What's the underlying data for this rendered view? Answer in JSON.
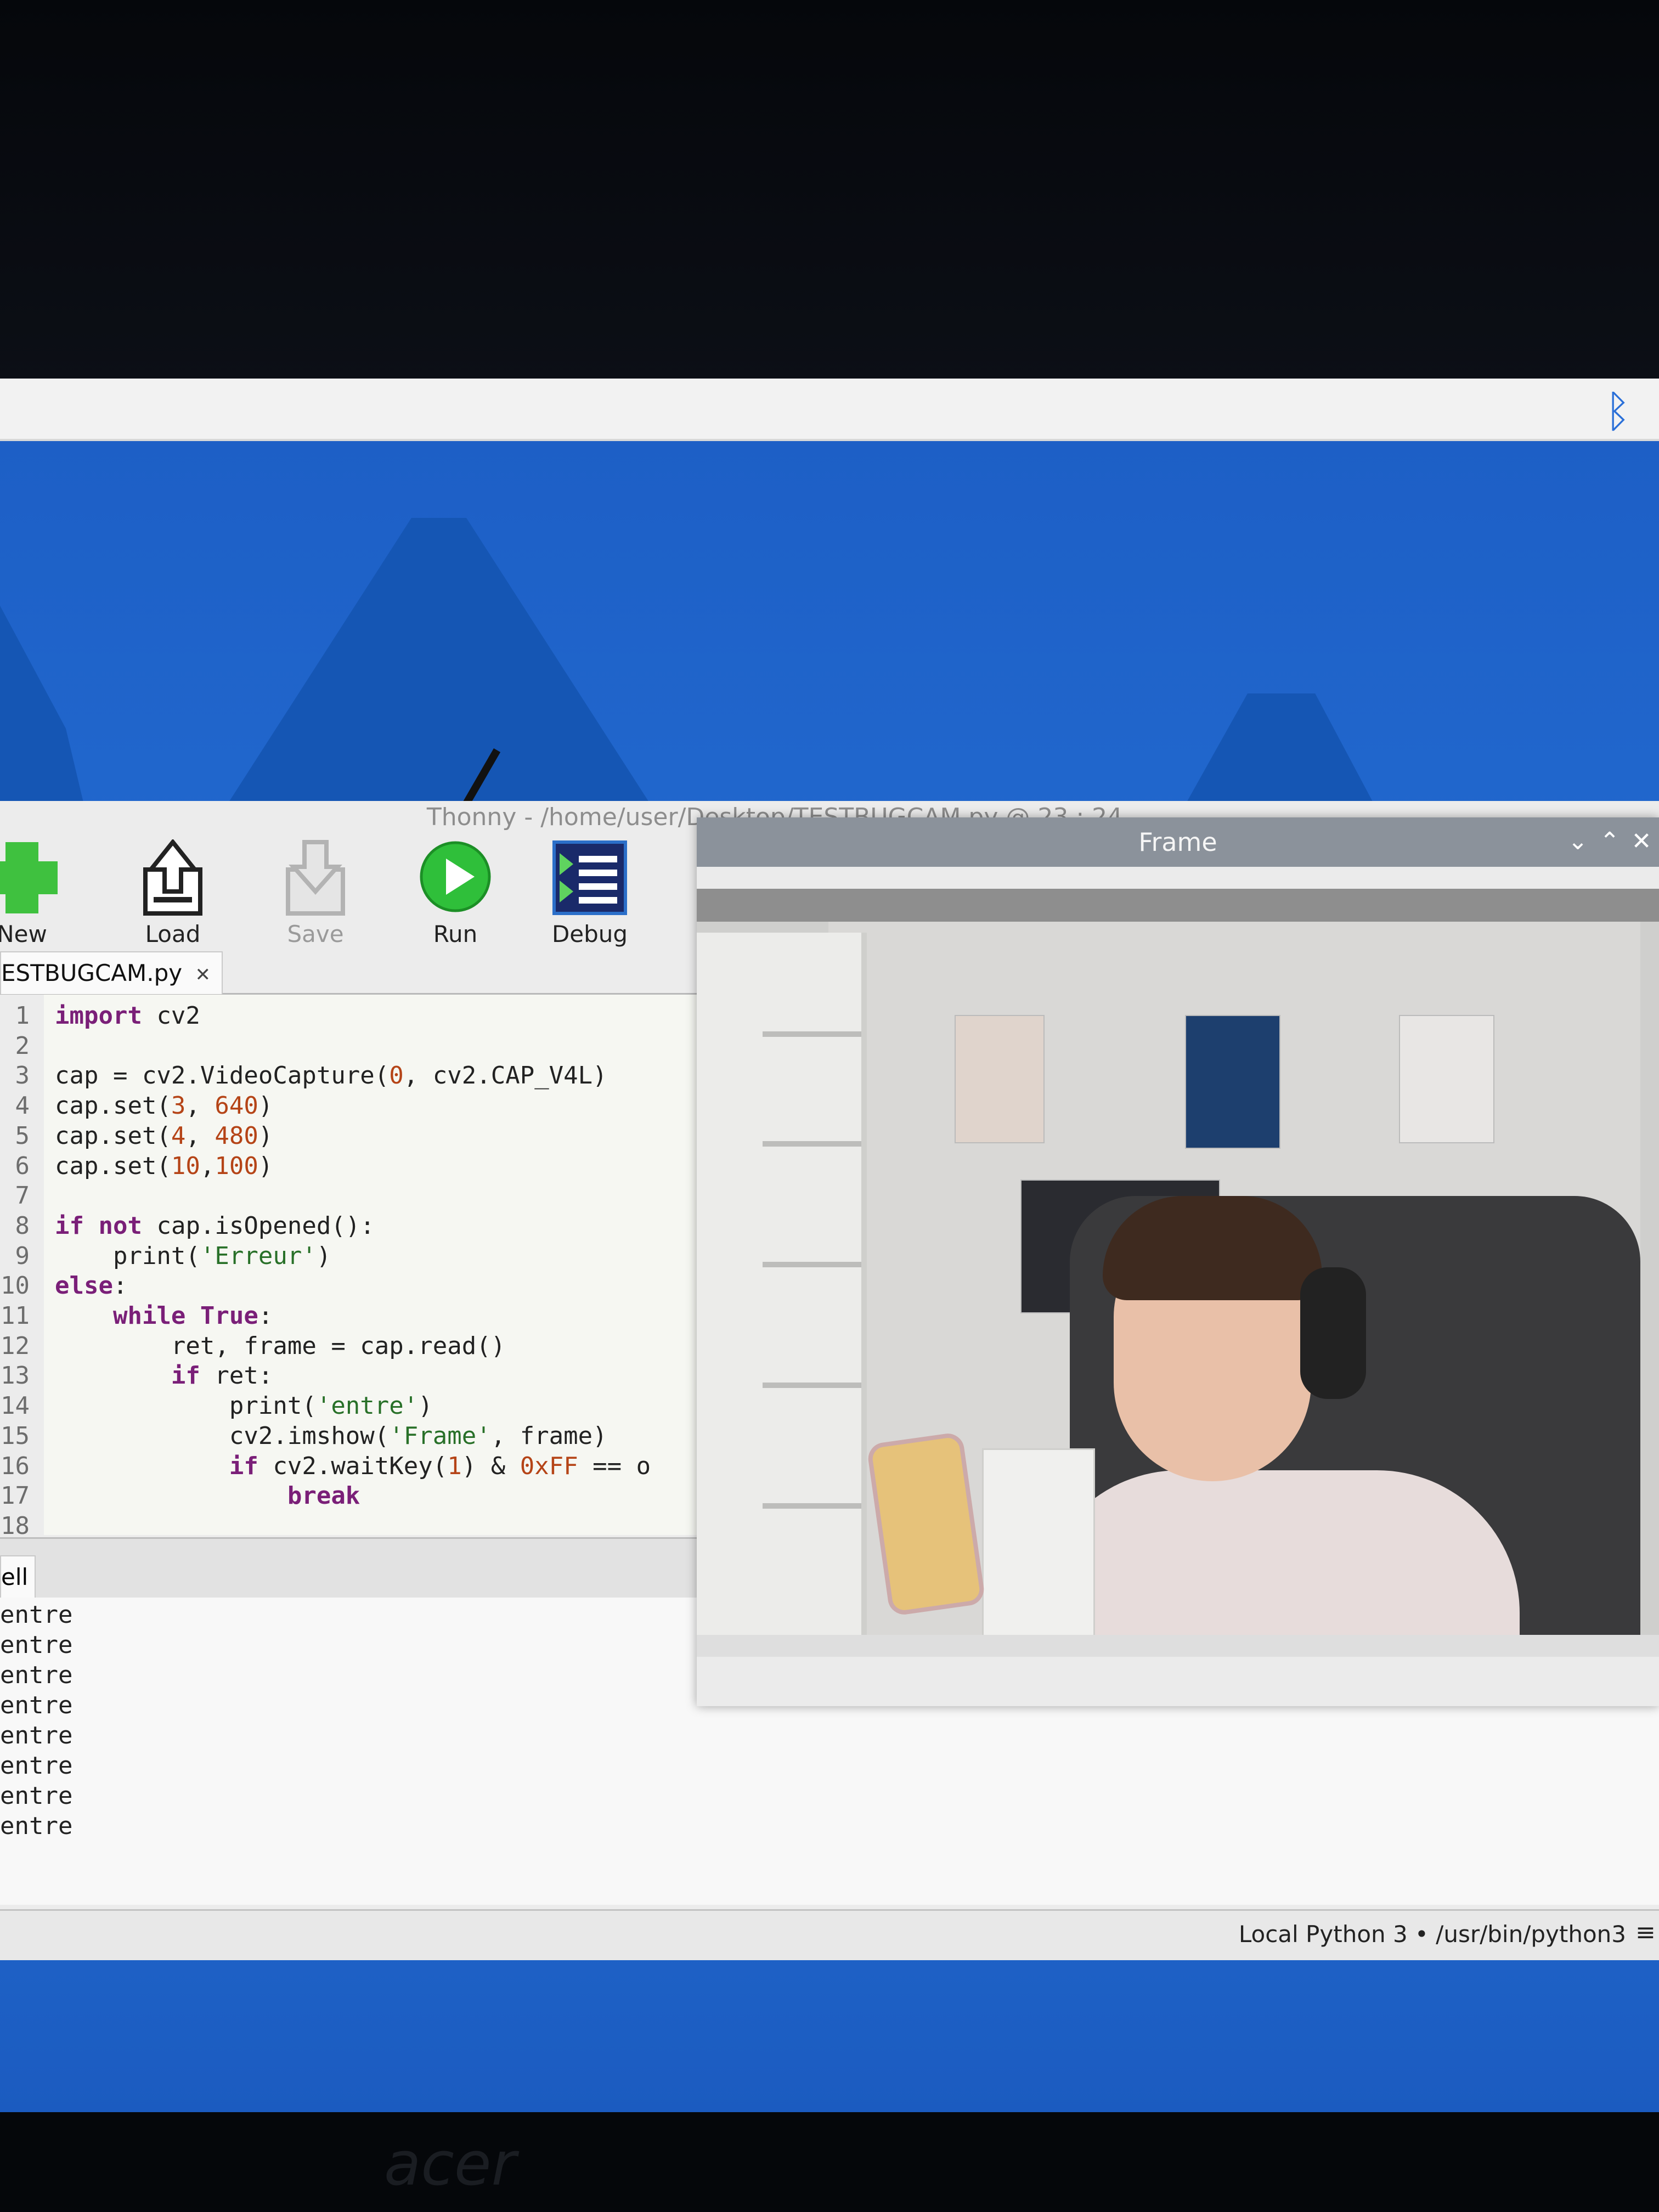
{
  "taskbar": {
    "bluetooth_icon": "bluetooth-icon"
  },
  "thonny": {
    "title": "Thonny  -  /home/user/Desktop/TESTBUGCAM.py  @  23 : 24",
    "toolbar": {
      "new_label": "New",
      "load_label": "Load",
      "save_label": "Save",
      "run_label": "Run",
      "debug_label": "Debug"
    },
    "tab": {
      "filename": "ESTBUGCAM.py",
      "close": "✕"
    },
    "editor": {
      "line_numbers": [
        "1",
        "2",
        "3",
        "4",
        "5",
        "6",
        "7",
        "8",
        "9",
        "10",
        "11",
        "12",
        "13",
        "14",
        "15",
        "16",
        "17",
        "18"
      ],
      "lines": [
        "import cv2",
        "",
        "cap = cv2.VideoCapture(0, cv2.CAP_V4L)",
        "cap.set(3, 640)",
        "cap.set(4, 480)",
        "cap.set(10,100)",
        "",
        "if not cap.isOpened():",
        "    print('Erreur')",
        "else:",
        "    while True:",
        "        ret, frame = cap.read()",
        "        if ret:",
        "            print('entre')",
        "            cv2.imshow('Frame', frame)",
        "            if cv2.waitKey(1) & 0xFF == o",
        "                break",
        ""
      ]
    },
    "shell": {
      "tab_label": "ell",
      "output": [
        "entre",
        "entre",
        "entre",
        "entre",
        "entre",
        "entre",
        "entre",
        "entre"
      ]
    },
    "status": {
      "interpreter": "Local Python 3  •  /usr/bin/python3",
      "menu_icon": "≡"
    }
  },
  "frame_window": {
    "title": "Frame",
    "buttons": {
      "minimize": "⌄",
      "maximize": "⌃",
      "close": "✕"
    }
  },
  "monitor": {
    "brand": "acer"
  }
}
